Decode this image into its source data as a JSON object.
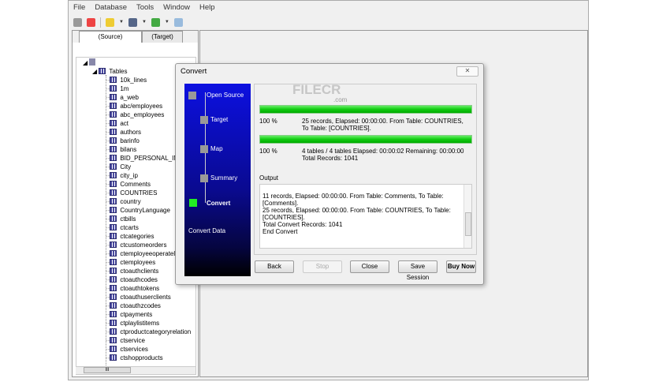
{
  "menu": [
    "File",
    "Database",
    "Tools",
    "Window",
    "Help"
  ],
  "tabs": {
    "source": "(Source)",
    "target": "(Target)"
  },
  "tree": {
    "root": "Tables",
    "items": [
      "10k_lines",
      "1m",
      "a_web",
      "abc/employees",
      "abc_employees",
      "act",
      "authors",
      "barinfo",
      "bilans",
      "BID_PERSONAL_INF",
      "City",
      "city_ip",
      "Comments",
      "COUNTRIES",
      "country",
      "CountryLanguage",
      "ctbills",
      "ctcarts",
      "ctcategories",
      "ctcustomeorders",
      "ctemployeeoperatelog",
      "ctemployees",
      "ctoauthclients",
      "ctoauthcodes",
      "ctoauthtokens",
      "ctoauthuserclients",
      "ctoauthzcodes",
      "ctpayments",
      "ctplaylistitems",
      "ctproductcategoryrelation",
      "ctservice",
      "ctservices",
      "ctshopproducts"
    ],
    "hscroll": "III"
  },
  "dialog": {
    "title": "Convert",
    "close": "✕",
    "watermark": "FILECR",
    "watermark_sub": ".com",
    "steps": [
      "Open Source",
      "Target",
      "Map",
      "Summary",
      "Convert"
    ],
    "step_desc": "Convert Data",
    "progress1": {
      "percent": 100,
      "label": "100 %",
      "line1": "25 records,    Elapsed: 00:00:00.    From Table: COUNTRIES,",
      "line2": "To Table: [COUNTRIES]."
    },
    "progress2": {
      "percent": 100,
      "label": "100 %",
      "line1": "4 tables / 4 tables    Elapsed: 00:00:02    Remaining: 00:00:00",
      "line2": "Total Records: 1041"
    },
    "output_label": "Output",
    "output_lines": [
      "11 records,    Elapsed: 00:00:00.    From Table: Comments,    To Table:",
      "[Comments].",
      "25 records,    Elapsed: 00:00:00.    From Table: COUNTRIES,    To Table:",
      "[COUNTRIES].",
      "Total Convert Records: 1041",
      "End Convert"
    ],
    "buttons": {
      "back": "Back",
      "stop": "Stop",
      "close": "Close",
      "save": "Save Session",
      "buy": "Buy Now"
    }
  }
}
